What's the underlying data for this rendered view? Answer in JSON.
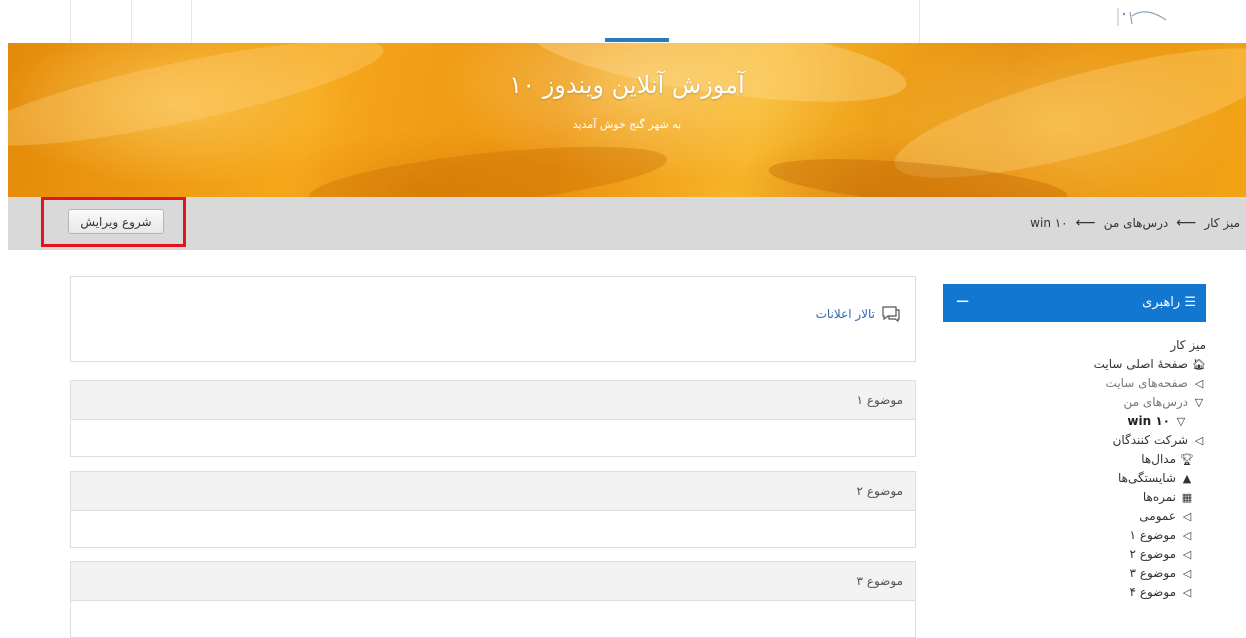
{
  "banner": {
    "title": "آموزش آنلاین ویندوز ۱۰",
    "subtitle": "به شهر گنج خوش آمدید"
  },
  "breadcrumb": [
    "میز کار",
    "درس‌های من",
    "win ۱۰"
  ],
  "edit_button_label": "شروع ویرایش",
  "main": {
    "forum_link": "تالار اعلانات",
    "topics": [
      "موضوع ۱",
      "موضوع ۲",
      "موضوع ۳"
    ]
  },
  "navigation": {
    "title": "راهبری",
    "collapse_symbol": "−",
    "items": [
      {
        "label": "میز کار",
        "icon": ""
      },
      {
        "label": "صفحهٔ اصلی سایت",
        "icon": "home-icon"
      },
      {
        "label": "صفحه‌های سایت",
        "icon": "caret-collapsed-icon"
      },
      {
        "label": "درس‌های من",
        "icon": "caret-expanded-icon"
      },
      {
        "label": "win ۱۰",
        "icon": "caret-expanded-icon"
      },
      {
        "label": "شرکت کنندگان",
        "icon": "caret-collapsed-icon"
      },
      {
        "label": "مدال‌ها",
        "icon": "trophy-icon"
      },
      {
        "label": "شایستگی‌ها",
        "icon": "competency-icon"
      },
      {
        "label": "نمره‌ها",
        "icon": "grid-icon"
      },
      {
        "label": "عمومی",
        "icon": "caret-collapsed-icon"
      },
      {
        "label": "موضوع ۱",
        "icon": "caret-collapsed-icon"
      },
      {
        "label": "موضوع ۲",
        "icon": "caret-collapsed-icon"
      },
      {
        "label": "موضوع ۳",
        "icon": "caret-collapsed-icon"
      },
      {
        "label": "موضوع ۴",
        "icon": "caret-collapsed-icon"
      }
    ]
  },
  "colors": {
    "accent": "#1177d1",
    "banner": "#f2a416",
    "highlight": "#e3141e"
  }
}
